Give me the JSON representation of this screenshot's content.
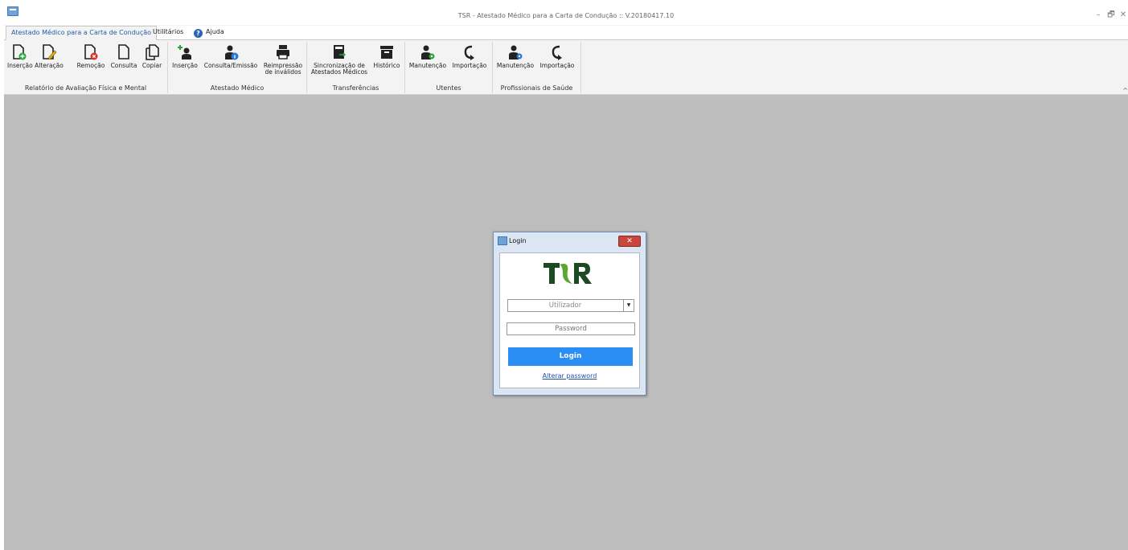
{
  "window": {
    "title": "TSR - Atestado Médico para a Carta de Condução :: V.20180417.10",
    "minimize": "–",
    "restore": "🗗",
    "close": "✕"
  },
  "tabs": [
    {
      "label": "Atestado Médico para a Carta de Condução",
      "active": true
    },
    {
      "label": "Utilitários",
      "active": false
    },
    {
      "label": "Ajuda",
      "active": false
    }
  ],
  "ribbon": {
    "groups": [
      {
        "label": "Relatório de Avaliação Física e Mental",
        "buttons": [
          "Inserção",
          "Alteração",
          "Remoção",
          "Consulta",
          "Copiar"
        ]
      },
      {
        "label": "Atestado Médico",
        "buttons": [
          "Inserção",
          "Consulta/Emissão",
          "Reimpressão\nde inválidos"
        ]
      },
      {
        "label": "Transferências",
        "buttons": [
          "Sincronização de\nAtestados Médicos",
          "Histórico"
        ]
      },
      {
        "label": "Utentes",
        "buttons": [
          "Manutenção",
          "Importação"
        ]
      },
      {
        "label": "Profissionais de Saúde",
        "buttons": [
          "Manutenção",
          "Importação"
        ]
      }
    ],
    "collapse": "^"
  },
  "login": {
    "title": "Login",
    "close": "✕",
    "logo_text": "TSR",
    "user_placeholder": "Utilizador",
    "password_placeholder": "Password",
    "button_label": "Login",
    "change_password": "Alterar password"
  },
  "colors": {
    "accent": "#2b8ef5",
    "logo_green": "#1c4a22",
    "workspace": "#bdbdbd"
  }
}
